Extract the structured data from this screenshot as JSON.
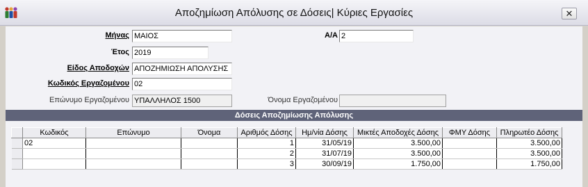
{
  "window": {
    "title": "Αποζημίωση Απόλυσης σε Δόσεις| Κύριες Εργασίες",
    "close_label": "✕"
  },
  "form": {
    "month_label": "Μήνας",
    "month_value": "ΜΑΙΟΣ",
    "aa_label": "Α/Α",
    "aa_value": "2",
    "year_label": "Έτος",
    "year_value": "2019",
    "earning_type_label": "Είδος Αποδοχών",
    "earning_type_value": "ΑΠΟΖΗΜΙΩΣΗ ΑΠΟΛΥΣΗΣ",
    "employee_code_label": "Κωδικός Εργαζομένου",
    "employee_code_value": "02",
    "surname_label": "Επώνυμο Εργαζομένου",
    "surname_value": "ΥΠΑΛΛΗΛΟΣ 1500",
    "firstname_label": "Όνομα Εργαζομένου",
    "firstname_value": ""
  },
  "section": {
    "title": "Δόσεις Αποζημίωσης Απόλυσης"
  },
  "grid": {
    "columns": [
      "Κωδικός",
      "Επώνυμο",
      "Όνομα",
      "Αριθμός Δόσης",
      "Ημ/νία Δόσης",
      "Μικτές Αποδοχές Δόσης",
      "ΦΜΥ Δόσης",
      "Πληρωτέο Δόσης"
    ],
    "rows": [
      [
        "02",
        "",
        "",
        "1",
        "31/05/19",
        "3.500,00",
        "",
        "3.500,00"
      ],
      [
        "",
        "",
        "",
        "2",
        "31/07/19",
        "3.500,00",
        "",
        "3.500,00"
      ],
      [
        "",
        "",
        "",
        "3",
        "30/09/19",
        "1.750,00",
        "",
        "1.750,00"
      ]
    ]
  }
}
